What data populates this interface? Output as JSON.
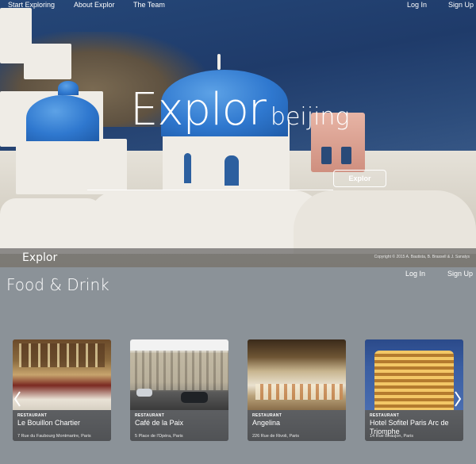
{
  "hero": {
    "nav": {
      "start": "Start Exploring",
      "about": "About Explor",
      "team": "The Team",
      "login": "Log In",
      "signup": "Sign Up"
    },
    "logo": "Explor",
    "city": "beijing",
    "search_button": "Explor",
    "footer_logo": "Explor",
    "copyright": "Copyright © 2015 A. Bautista, B. Brassell & J. Sanatys"
  },
  "section": {
    "title": "Food & Drink",
    "login": "Log In",
    "signup": "Sign Up"
  },
  "cards": [
    {
      "category": "RESTAURANT",
      "name": "Le Bouillon Chartier",
      "address": "7 Rue du Faubourg Montmartre, Paris"
    },
    {
      "category": "RESTAURANT",
      "name": "Café de la Paix",
      "address": "5 Place de l'Opéra, Paris"
    },
    {
      "category": "RESTAURANT",
      "name": "Angelina",
      "address": "226 Rue de Rivoli, Paris"
    },
    {
      "category": "RESTAURANT",
      "name": "Hotel Sofitel Paris Arc de Triomphe",
      "address": "14 Rue Beaujon, Paris"
    }
  ]
}
